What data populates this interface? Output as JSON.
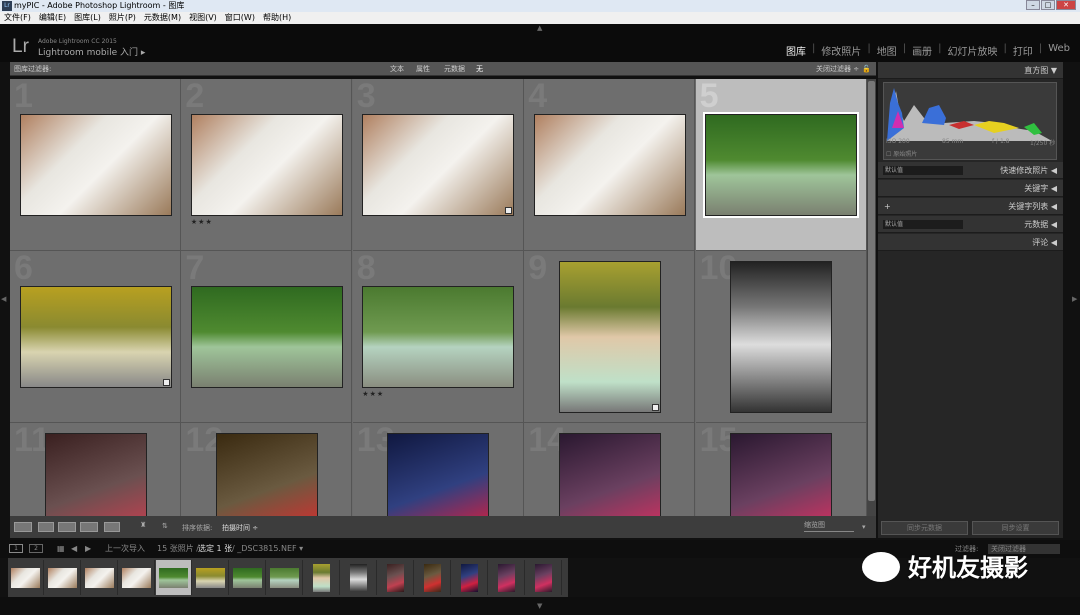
{
  "window": {
    "title": "myPIC - Adobe Photoshop Lightroom - 图库",
    "icon": "lr-icon"
  },
  "menu": [
    "文件(F)",
    "编辑(E)",
    "图库(L)",
    "照片(P)",
    "元数据(M)",
    "视图(V)",
    "窗口(W)",
    "帮助(H)"
  ],
  "identity": {
    "logo": "Lr",
    "version": "Adobe Lightroom CC 2015",
    "mobile": "Lightroom mobile 入门 ▸"
  },
  "modules": [
    {
      "label": "图库",
      "active": true
    },
    {
      "label": "修改照片"
    },
    {
      "label": "地图"
    },
    {
      "label": "画册"
    },
    {
      "label": "幻灯片放映"
    },
    {
      "label": "打印"
    },
    {
      "label": "Web"
    }
  ],
  "filter_bar": {
    "title": "图库过滤器:",
    "options": [
      "文本",
      "属性",
      "元数据",
      "无"
    ],
    "active": "无",
    "preset": "关闭过滤器 ÷"
  },
  "grid": {
    "cells": [
      {
        "n": "1",
        "kind": "classroom",
        "orient": "l"
      },
      {
        "n": "2",
        "kind": "classroom",
        "orient": "l",
        "stars": "★★★"
      },
      {
        "n": "3",
        "kind": "classroom",
        "orient": "l",
        "badge": true
      },
      {
        "n": "4",
        "kind": "classroom",
        "orient": "l"
      },
      {
        "n": "5",
        "kind": "park",
        "orient": "l",
        "selected": true
      },
      {
        "n": "6",
        "kind": "yellow",
        "orient": "l",
        "badge": true
      },
      {
        "n": "7",
        "kind": "park",
        "orient": "l"
      },
      {
        "n": "8",
        "kind": "park2",
        "orient": "l",
        "stars": "★★★"
      },
      {
        "n": "9",
        "kind": "yellowp",
        "orient": "p",
        "badge": true
      },
      {
        "n": "10",
        "kind": "bw",
        "orient": "p"
      },
      {
        "n": "11",
        "kind": "dark",
        "orient": "p"
      },
      {
        "n": "12",
        "kind": "warm",
        "orient": "p"
      },
      {
        "n": "13",
        "kind": "blue",
        "orient": "p"
      },
      {
        "n": "14",
        "kind": "purple",
        "orient": "p"
      },
      {
        "n": "15",
        "kind": "purple",
        "orient": "p"
      }
    ]
  },
  "toolbar": {
    "sort_label": "排序依据:",
    "sort_value": "拍摄时间 ÷",
    "thumb_label": "缩览图"
  },
  "right_panel": {
    "histogram_title": "直方图",
    "iso": "ISO 200",
    "focal": "85 mm",
    "aperture": "f / 1.8",
    "shutter": "1/250 秒",
    "original": "原始照片",
    "sections": [
      {
        "label": "快速修改照片",
        "select": "默认值"
      },
      {
        "label": "关键字"
      },
      {
        "label": "关键字列表",
        "plus": "+"
      },
      {
        "label": "元数据",
        "select": "默认值"
      },
      {
        "label": "评论"
      }
    ],
    "sync_metadata": "同步元数据",
    "sync_settings": "同步设置"
  },
  "status": {
    "pages": [
      "1",
      "2"
    ],
    "source": "上一次导入",
    "count": "15 张照片 /",
    "selected": "选定 1 张",
    "file": "/ _DSC3815.NEF ▾",
    "filter_label": "过滤器:",
    "filter_value": "关闭过滤器"
  },
  "watermark": "好机友摄影",
  "colors": {
    "selected_cell": "#bdbdbd",
    "grid_bg": "#6b6b6b"
  }
}
